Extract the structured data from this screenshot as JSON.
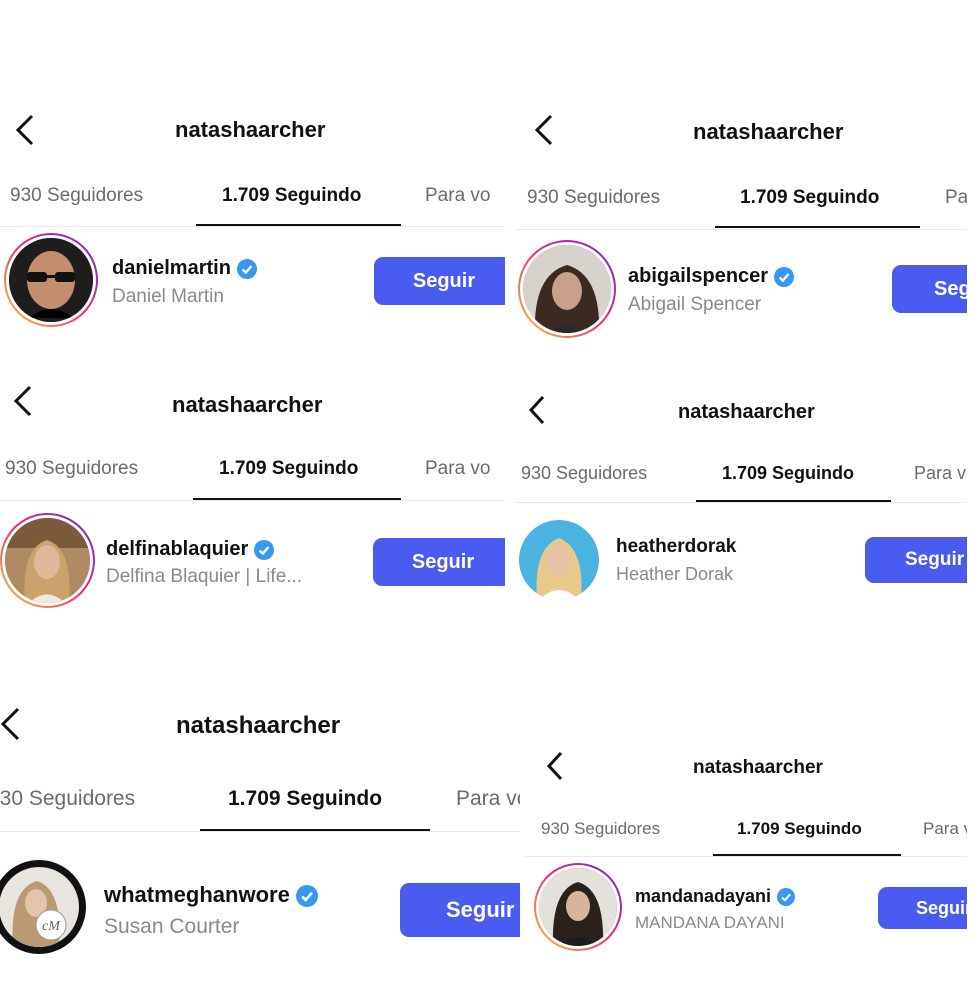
{
  "title": "natashaarcher",
  "tabs": {
    "followers": "930 Seguidores",
    "following": "1.709 Seguindo",
    "for_you": "Para vo"
  },
  "follow_label": "Seguir",
  "colors": {
    "button": "#4a5cf0",
    "verified": "#3897f0"
  },
  "panels": [
    {
      "username": "danielmartin",
      "fullname": "Daniel Martin",
      "verified": true,
      "story_ring": true,
      "icon": "profile-photo"
    },
    {
      "username": "abigailspencer",
      "fullname": "Abigail Spencer",
      "verified": true,
      "story_ring": true,
      "icon": "profile-photo"
    },
    {
      "username": "delfinablaquier",
      "fullname": "Delfina Blaquier | Life...",
      "verified": true,
      "story_ring": true,
      "icon": "profile-photo"
    },
    {
      "username": "heatherdorak",
      "fullname": "Heather Dorak",
      "verified": false,
      "story_ring": false,
      "icon": "profile-photo"
    },
    {
      "username": "whatmeghanwore",
      "fullname": "Susan Courter",
      "verified": true,
      "story_ring": false,
      "icon": "profile-photo"
    },
    {
      "username": "mandanadayani",
      "fullname": "MANDANA DAYANI",
      "verified": true,
      "story_ring": true,
      "icon": "profile-photo"
    }
  ]
}
